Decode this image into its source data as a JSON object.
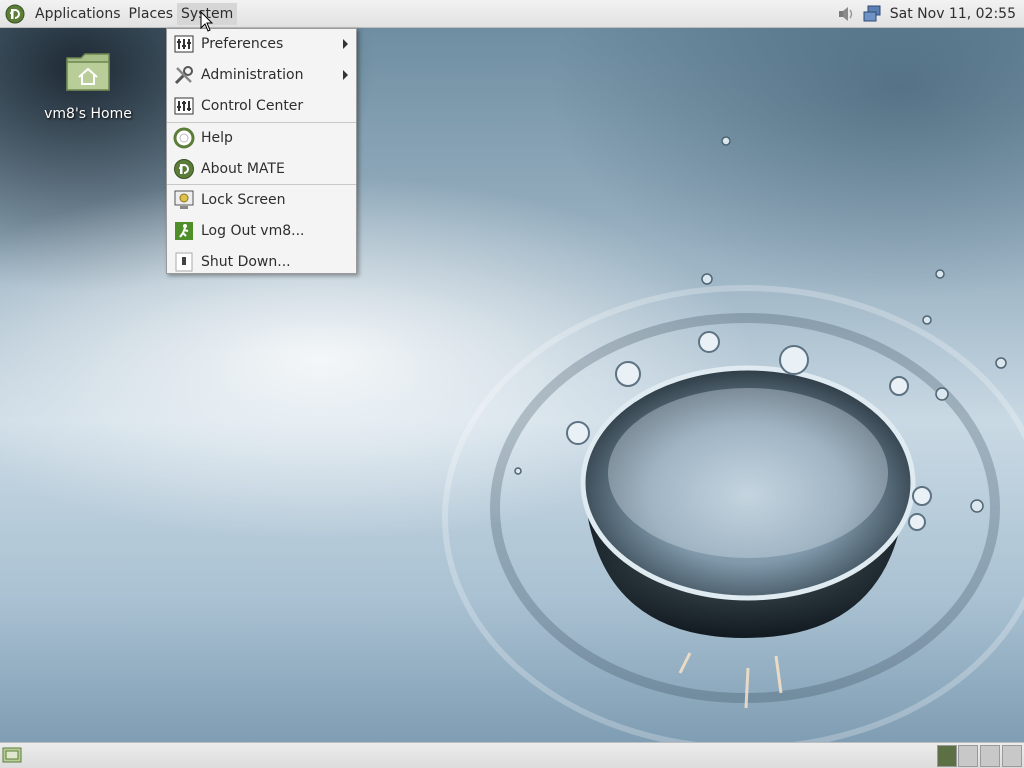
{
  "top_panel": {
    "menus": [
      "Applications",
      "Places",
      "System"
    ],
    "clock": "Sat Nov 11, 02:55",
    "tray_icons": [
      "volume-icon",
      "network-icon"
    ]
  },
  "system_menu": {
    "items": [
      {
        "label": "Preferences",
        "icon": "preferences-icon",
        "submenu": true
      },
      {
        "label": "Administration",
        "icon": "administration-icon",
        "submenu": true
      },
      {
        "label": "Control Center",
        "icon": "control-center-icon",
        "submenu": false
      },
      {
        "label": "Help",
        "icon": "help-icon",
        "submenu": false
      },
      {
        "label": "About MATE",
        "icon": "mate-logo-icon",
        "submenu": false
      },
      {
        "label": "Lock Screen",
        "icon": "lock-screen-icon",
        "submenu": false
      },
      {
        "label": "Log Out vm8...",
        "icon": "logout-icon",
        "submenu": false
      },
      {
        "label": "Shut Down...",
        "icon": "shutdown-icon",
        "submenu": false
      }
    ]
  },
  "desktop": {
    "icons": [
      {
        "label": "vm8's Home",
        "icon": "home-folder-icon"
      }
    ]
  },
  "bottom_panel": {
    "workspaces": 4,
    "active_workspace": 1
  },
  "colors": {
    "panel": "#e6e6e6",
    "menu_bg": "#f4f4f4",
    "mate_green": "#5c7d3a"
  }
}
